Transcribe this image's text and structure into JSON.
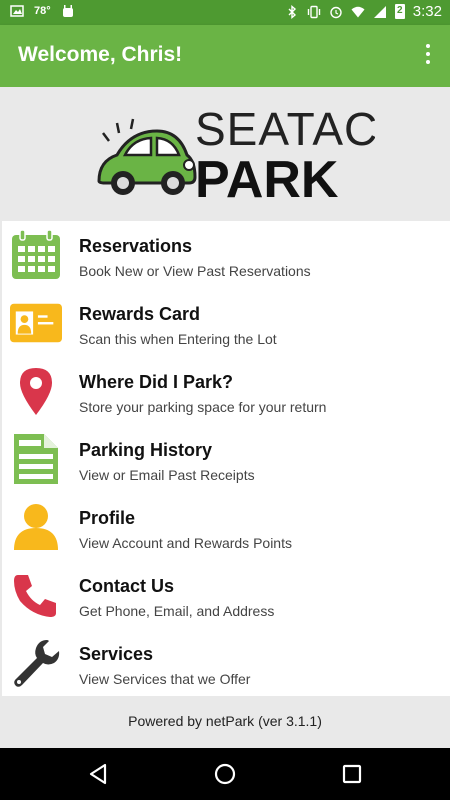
{
  "status_bar": {
    "temperature": "78°",
    "time": "3:32",
    "battery": "2"
  },
  "app_bar": {
    "title": "Welcome, Chris!"
  },
  "logo": {
    "line1": "SEATAC",
    "line2": "PARK"
  },
  "menu": {
    "items": [
      {
        "title": "Reservations",
        "subtitle": "Book New or View Past Reservations",
        "icon": "calendar-icon",
        "color": "#7dbe52"
      },
      {
        "title": "Rewards Card",
        "subtitle": "Scan this when Entering the Lot",
        "icon": "id-card-icon",
        "color": "#f8b81c"
      },
      {
        "title": "Where Did I Park?",
        "subtitle": "Store your parking space for your return",
        "icon": "map-pin-icon",
        "color": "#d9364b"
      },
      {
        "title": "Parking History",
        "subtitle": "View or Email Past Receipts",
        "icon": "document-icon",
        "color": "#7dbe52"
      },
      {
        "title": "Profile",
        "subtitle": "View Account and Rewards Points",
        "icon": "person-icon",
        "color": "#f8b81c"
      },
      {
        "title": "Contact Us",
        "subtitle": "Get Phone, Email, and Address",
        "icon": "phone-icon",
        "color": "#d9364b"
      },
      {
        "title": "Services",
        "subtitle": "View Services that we Offer",
        "icon": "wrench-icon",
        "color": "#333333"
      }
    ]
  },
  "footer": {
    "text": "Powered by netPark (ver 3.1.1)"
  },
  "colors": {
    "status_bar": "#4e9a31",
    "app_bar": "#6ab445",
    "background": "#e9e9e9"
  }
}
